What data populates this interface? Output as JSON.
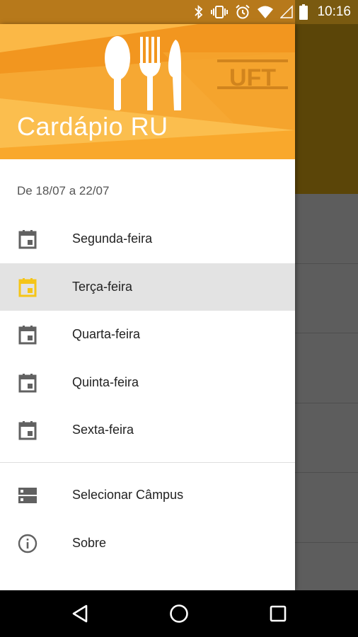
{
  "status_bar": {
    "time": "10:16",
    "icons": [
      "bluetooth-icon",
      "vibrate-icon",
      "alarm-icon",
      "wifi-icon",
      "signal-icon",
      "battery-icon"
    ]
  },
  "drawer": {
    "header": {
      "title": "Cardápio RU",
      "logo_text": "UFT",
      "colors": {
        "light": "#f9b23f",
        "mid": "#f3a12c",
        "dark": "#e8891b"
      }
    },
    "week_range": "De 18/07 a 22/07",
    "days": [
      {
        "label": "Segunda-feira",
        "icon": "calendar-icon",
        "selected": false
      },
      {
        "label": "Terça-feira",
        "icon": "calendar-icon",
        "selected": true
      },
      {
        "label": "Quarta-feira",
        "icon": "calendar-icon",
        "selected": false
      },
      {
        "label": "Quinta-feira",
        "icon": "calendar-icon",
        "selected": false
      },
      {
        "label": "Sexta-feira",
        "icon": "calendar-icon",
        "selected": false
      }
    ],
    "extras": [
      {
        "label": "Selecionar Câmpus",
        "icon": "storage-icon"
      },
      {
        "label": "Sobre",
        "icon": "info-icon"
      }
    ],
    "accent_color": "#f5c518"
  },
  "navigation_bar": {
    "buttons": [
      "back-icon",
      "home-icon",
      "recents-icon"
    ]
  }
}
